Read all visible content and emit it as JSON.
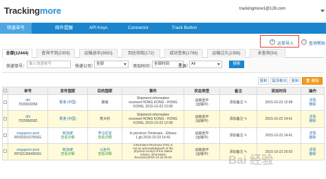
{
  "header": {
    "logo_main": "Tracking",
    "logo_accent": "more",
    "account": "trackingmore1@126.com"
  },
  "nav": {
    "items": [
      "快速单号",
      "邮件提醒",
      "API Keys",
      "Connector",
      "Track Button"
    ],
    "active": 0
  },
  "actions": {
    "import_label": "运单导入",
    "query_label": "查询帮助"
  },
  "tabs": [
    {
      "label": "全部(12444)"
    },
    {
      "label": "查询不到(2309)"
    },
    {
      "label": "运输途中(3650)"
    },
    {
      "label": "到达待取(172)"
    },
    {
      "label": "成功签收(1796)"
    },
    {
      "label": "运输过久(1396)"
    },
    {
      "label": "未查询(54)"
    }
  ],
  "filters": {
    "tracking_label": "快递单号：",
    "tracking_placeholder": "输入快递单号",
    "carrier_label": "快递公司：",
    "carrier_value": "全部",
    "date_label": "添加时间：",
    "date_value": "全部时间",
    "source_label": "来源：",
    "source_value": "All",
    "search_btn": "搜索"
  },
  "toolbar": {
    "copy": "复制",
    "mark": "错误看法",
    "export": "复制",
    "delete": "删除"
  },
  "table": {
    "headers": [
      "单号",
      "发件国家",
      "目的国家",
      "事件",
      "状态类型",
      "备注",
      "添加时间",
      "操作"
    ],
    "rows": [
      {
        "tracking": [
          "dhl",
          "7020919356"
        ],
        "origin": [
          "香港 (中国)"
        ],
        "dest": [
          "挪威"
        ],
        "event": [
          "Shipment information",
          "received HONG KONG - HONG",
          "KONG, 2015-10-23 12:08"
        ],
        "status": [
          "运输途中",
          "(运输中)"
        ],
        "note": "添加备注",
        "time": "2015-10-23 12:08",
        "ops": [
          "详情",
          "删除"
        ]
      },
      {
        "tracking": [
          "dhl",
          "7020956582"
        ],
        "origin": [
          "香港 (中国)"
        ],
        "dest": [
          "意大利"
        ],
        "event": [
          "Shipment information",
          "received HONG KONG - HONG",
          "KONG, 2015-10-23 12:08"
        ],
        "status": [
          "运输途中",
          "(运输中)"
        ],
        "note": "添加备注",
        "time": "2015-10-23 14:41",
        "ops": [
          "详情",
          "删除"
        ]
      },
      {
        "tracking": [
          "singapore-post",
          "RP323101755SG"
        ],
        "origin": [
          "新加坡",
          "查看详细"
        ],
        "dest": [
          "罗马尼亚",
          "查看详细"
        ],
        "event": [
          "In province-Timisoara - Ghiseu",
          "1 gh.2015-10-23 14:41"
        ],
        "status": [
          "运输途中",
          "(运输中)"
        ],
        "note": "添加备注",
        "time": "2015-10-23 14:41",
        "ops": [
          "详情",
          "删除"
        ]
      },
      {
        "tracking": [
          "singapore-post",
          "RP321366495SG"
        ],
        "origin": [
          "新加坡",
          "查看详细"
        ],
        "dest": [
          "以色列",
          "查看详细"
        ],
        "event": [
          "Information Received (This is",
          "not an acknowledgment of the",
          "physical receipt of the stated",
          "Article), Information",
          "Received,2015-10-23 20:03"
        ],
        "status": [
          "运输途中",
          "(运输中)"
        ],
        "note": "添加备注",
        "time": "2015-10-23 20:03",
        "ops": [
          "详情",
          "删除"
        ]
      }
    ]
  },
  "watermark": "Bai 经验"
}
